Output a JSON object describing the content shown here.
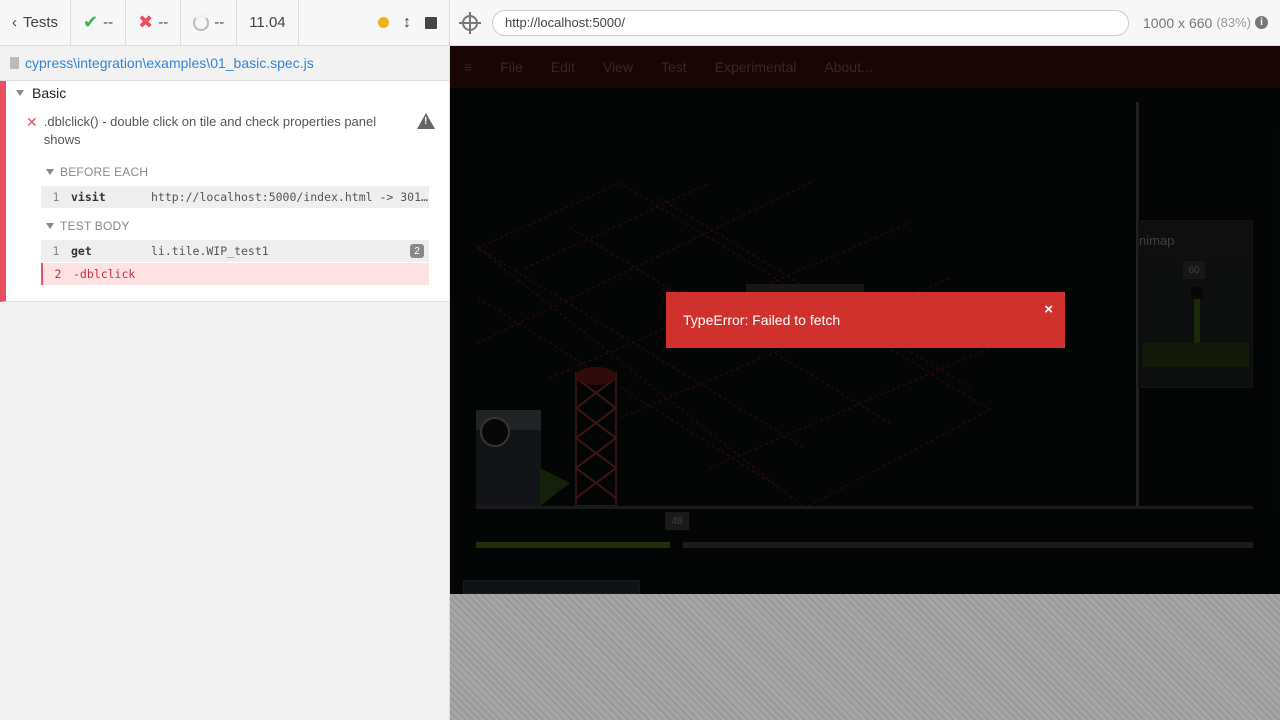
{
  "reporter": {
    "tests_label": "Tests",
    "passed": "--",
    "failed": "--",
    "pending": "--",
    "duration": "11.04",
    "spec_path": "cypress\\integration\\examples\\01_basic.spec.js",
    "suite_title": "Basic",
    "test_title": ".dblclick() - double click on tile and check properties panel shows",
    "before_each_label": "BEFORE EACH",
    "test_body_label": "TEST BODY",
    "commands_before": [
      {
        "num": "1",
        "name": "visit",
        "message": "http://localhost:5000/index.html -> 301:…"
      }
    ],
    "commands_body": [
      {
        "num": "1",
        "name": "get",
        "message": "li.tile.WIP_test1",
        "badge": "2"
      },
      {
        "num": "2",
        "name": "-dblclick",
        "message": ""
      }
    ]
  },
  "aut": {
    "url": "http://localhost:5000/",
    "viewport": "1000 x 660",
    "scale": "(83%)",
    "menu": [
      "File",
      "Edit",
      "View",
      "Test",
      "Experimental",
      "About..."
    ],
    "minimap_label": "nimap",
    "minimap_value": "60",
    "slider_value": "48",
    "error_message": "TypeError: Failed to fetch",
    "close_glyph": "×"
  },
  "colors": {
    "fail": "#e94f5f",
    "pass": "#3fb34f",
    "toast": "#d0312d",
    "link": "#3385d6"
  }
}
